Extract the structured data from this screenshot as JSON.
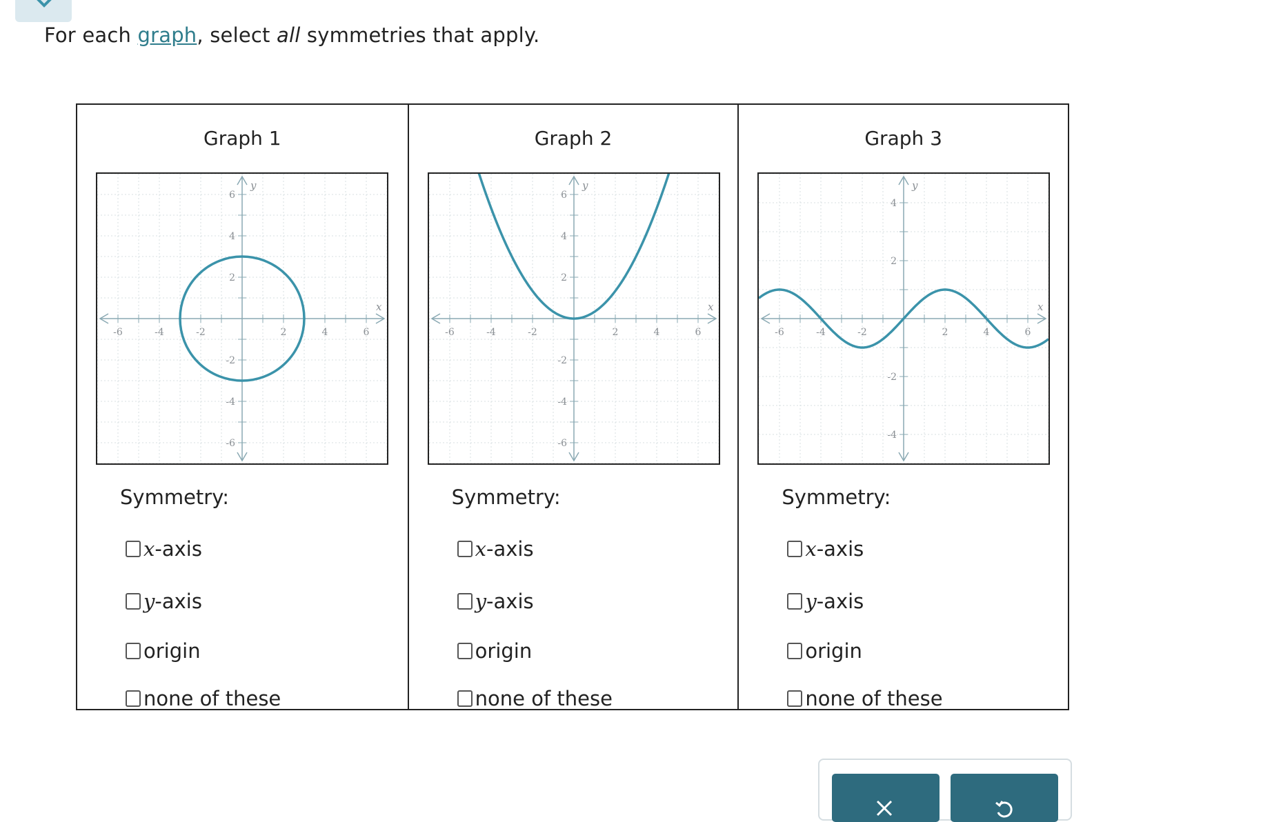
{
  "prompt": {
    "before": "For each ",
    "link": "graph",
    "after": ", select ",
    "emph": "all",
    "tail": " symmetries that apply."
  },
  "colors": {
    "accent": "#2f7d8c",
    "curve": "#3b93aa",
    "button": "#2e6b7e",
    "axis": "#8aa9b3"
  },
  "symmetry_label": "Symmetry:",
  "options": {
    "x_var": "x",
    "y_var": "y",
    "axis_suffix": "-axis",
    "origin": "origin",
    "none": "none of these"
  },
  "axis_labels": {
    "x": "x",
    "y": "y"
  },
  "graphs": [
    {
      "title": "Graph 1",
      "xticks": [
        "-6",
        "-4",
        "-2",
        "2",
        "4",
        "6"
      ],
      "yticks": [
        "6",
        "4",
        "2",
        "-2",
        "-4",
        "-6"
      ],
      "curve": "circle",
      "radius": 3,
      "center": [
        0,
        0
      ]
    },
    {
      "title": "Graph 2",
      "xticks": [
        "-6",
        "-4",
        "-2",
        "2",
        "4",
        "6"
      ],
      "yticks": [
        "6",
        "4",
        "2",
        "-2",
        "-4",
        "-6"
      ],
      "curve": "parabola",
      "equation": "y = x^2/3"
    },
    {
      "title": "Graph 3",
      "xticks": [
        "-6",
        "-4",
        "-2",
        "2",
        "4",
        "6"
      ],
      "yticks": [
        "4",
        "2",
        "-2",
        "-4"
      ],
      "curve": "wave",
      "amplitude": 1,
      "peaks_at_x": [
        -6,
        2
      ],
      "troughs_at_x": [
        -2,
        6
      ]
    }
  ],
  "icons": {
    "top_chip": "chevron-down-icon",
    "clear": "close-icon",
    "undo": "undo-icon"
  }
}
